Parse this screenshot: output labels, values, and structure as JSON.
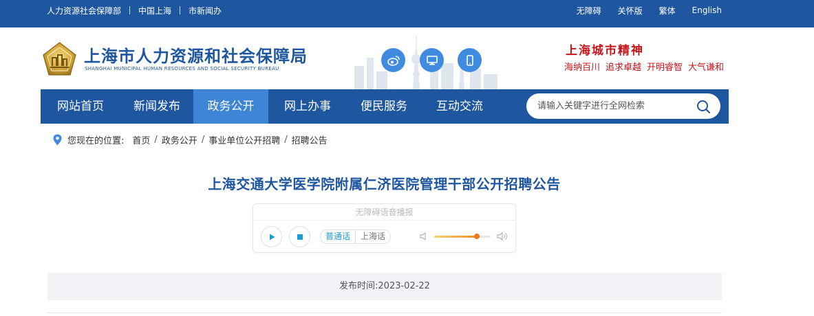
{
  "top_bar": {
    "left_links": [
      "人力资源社会保障部",
      "中国上海",
      "市新闻办"
    ],
    "right_links": [
      "无障碍",
      "关怀版",
      "繁体",
      "English"
    ]
  },
  "header": {
    "title": "上海市人力资源和社会保障局",
    "subtitle": "SHANGHAI MUNICIPAL HUMAN RESOURCES AND SOCIAL SECURITY BUREAU",
    "social_icons": [
      "weibo-icon",
      "computer-icon",
      "mobile-icon"
    ],
    "slogan_title": "上海城市精神",
    "slogan_items": [
      "海纳百川",
      "追求卓越",
      "开明睿智",
      "大气谦和"
    ]
  },
  "nav": {
    "items": [
      "网站首页",
      "新闻发布",
      "政务公开",
      "网上办事",
      "便民服务",
      "互动交流"
    ],
    "active": "政务公开",
    "search_placeholder": "请输入关键字进行全网检索"
  },
  "breadcrumb": {
    "lead": "您现在的位置:",
    "items": [
      "首页",
      "政务公开",
      "事业单位公开招聘",
      "招聘公告"
    ]
  },
  "article": {
    "title": "上海交通大学医学院附属仁济医院管理干部公开招聘公告",
    "date_label": "发布时间:",
    "date_value": "2023-02-22"
  },
  "player": {
    "title": "无障碍语音播报",
    "languages": [
      "普通话",
      "上海话"
    ],
    "selected_language": "普通话",
    "volume": 0.75
  },
  "colors": {
    "brand_blue": "#1e56a0",
    "nav_active": "#3f85d6",
    "slogan_red": "#c4161c",
    "player_accent": "#1e9ad6"
  }
}
